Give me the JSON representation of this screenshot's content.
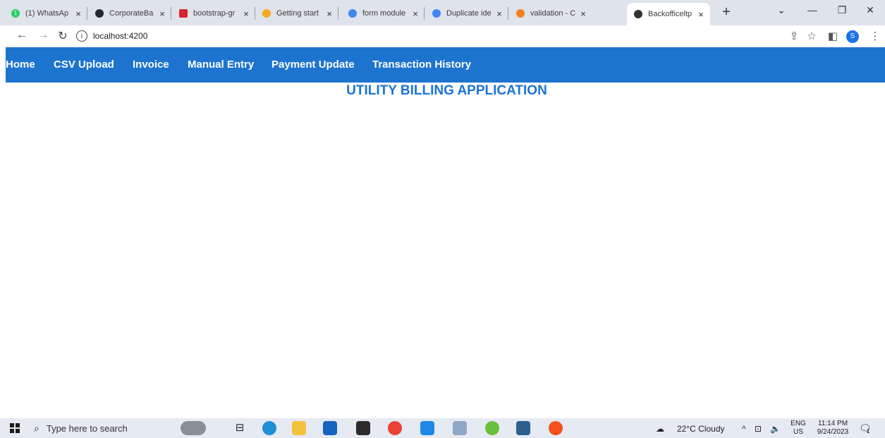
{
  "browser": {
    "tabs": [
      {
        "title": "(1) WhatsAp",
        "icon": "whatsapp-icon",
        "badge": "1",
        "active": false
      },
      {
        "title": "CorporateBa",
        "icon": "github-icon",
        "active": false
      },
      {
        "title": "bootstrap-gr",
        "icon": "bootstrap-icon",
        "active": false
      },
      {
        "title": "Getting start",
        "icon": "shield-icon",
        "active": false
      },
      {
        "title": "form module",
        "icon": "google-icon",
        "active": false
      },
      {
        "title": "Duplicate ide",
        "icon": "google-icon",
        "active": false
      },
      {
        "title": "validation - C",
        "icon": "stackoverflow-icon",
        "active": false
      },
      {
        "title": "Backofficeltp",
        "icon": "angular-icon",
        "active": true
      }
    ],
    "close_glyph": "×",
    "new_tab_glyph": "+",
    "url": "localhost:4200",
    "info_glyph": "i",
    "profile_initial": "S"
  },
  "app": {
    "nav": [
      "Home",
      "CSV Upload",
      "Invoice",
      "Manual Entry",
      "Payment Update",
      "Transaction History"
    ],
    "title": "UTILITY BILLING APPLICATION"
  },
  "taskbar": {
    "search_placeholder": "Type here to search",
    "weather": "22°C  Cloudy",
    "lang_top": "ENG",
    "lang_bottom": "US",
    "time": "11:14 PM",
    "date": "9/24/2023",
    "notification_badge": "1"
  },
  "colors": {
    "nav_bg": "#1d74ce",
    "title_color": "#1a73d8",
    "tabstrip_bg": "#dfe3eb"
  }
}
